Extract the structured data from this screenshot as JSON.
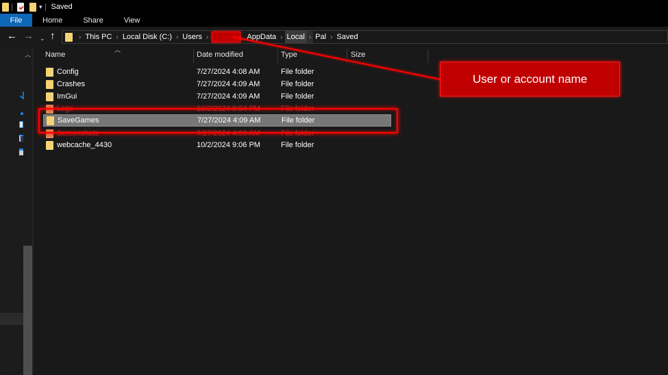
{
  "window": {
    "title": "Saved"
  },
  "ribbon": {
    "tabs": [
      {
        "label": "File",
        "active": true
      },
      {
        "label": "Home"
      },
      {
        "label": "Share"
      },
      {
        "label": "View"
      }
    ]
  },
  "navigation": {
    "back_icon": "←",
    "forward_icon": "→",
    "recent_icon": "⌄",
    "up_icon": "↑"
  },
  "breadcrumb": {
    "items": [
      {
        "label": "This PC"
      },
      {
        "label": "Local Disk (C:)"
      },
      {
        "label": "Users"
      },
      {
        "label": "",
        "redacted": true
      },
      {
        "label": "AppData"
      },
      {
        "label": "Local"
      },
      {
        "label": "Pal"
      },
      {
        "label": "Saved"
      }
    ]
  },
  "columns": {
    "name": "Name",
    "date_modified": "Date modified",
    "type": "Type",
    "size": "Size"
  },
  "files": [
    {
      "name": "Config",
      "date": "7/27/2024 4:08 AM",
      "type": "File folder",
      "size": ""
    },
    {
      "name": "Crashes",
      "date": "7/27/2024 4:09 AM",
      "type": "File folder",
      "size": ""
    },
    {
      "name": "ImGui",
      "date": "7/27/2024 4:09 AM",
      "type": "File folder",
      "size": ""
    },
    {
      "name": "Logs",
      "date": "10/2/2024 9:04 PM",
      "type": "File folder",
      "size": ""
    },
    {
      "name": "SaveGames",
      "date": "7/27/2024 4:09 AM",
      "type": "File folder",
      "size": "",
      "selected": true
    },
    {
      "name": "Screenshots",
      "date": "7/27/2024 4:09 AM",
      "type": "File folder",
      "size": ""
    },
    {
      "name": "webcache_4430",
      "date": "10/2/2024 9:06 PM",
      "type": "File folder",
      "size": ""
    }
  ],
  "annotation": {
    "callout_text": "User or account name",
    "accent_color": "#ff0000"
  }
}
